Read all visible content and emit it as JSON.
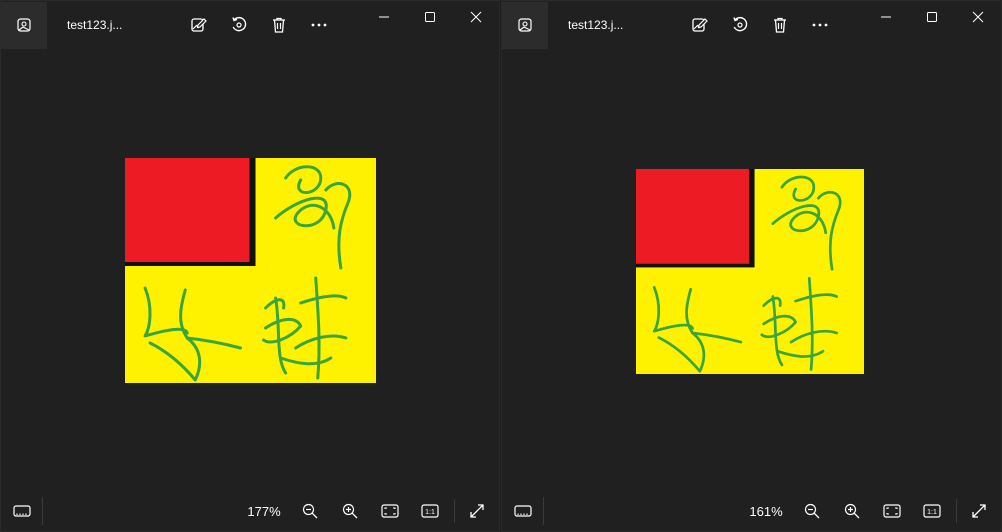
{
  "windows": [
    {
      "filename": "test123.j...",
      "zoom": "177%",
      "ratio_label": "1:1"
    },
    {
      "filename": "test123.j...",
      "zoom": "161%",
      "ratio_label": "1:1"
    }
  ],
  "image": {
    "background_color": "#fff200",
    "square_color": "#ed1c24",
    "signature_color": "#3aa53a"
  },
  "icons": {
    "app": "photos-app-icon",
    "edit": "edit-image-icon",
    "rotate": "rotate-icon",
    "delete": "trash-icon",
    "more": "more-options-icon",
    "minimize": "minimize-icon",
    "maximize": "maximize-icon",
    "close": "close-icon",
    "filmstrip": "filmstrip-icon",
    "zoom_out": "zoom-out-icon",
    "zoom_in": "zoom-in-icon",
    "fit": "fit-to-window-icon",
    "actual_size": "actual-size-icon",
    "full_screen": "full-screen-icon"
  }
}
